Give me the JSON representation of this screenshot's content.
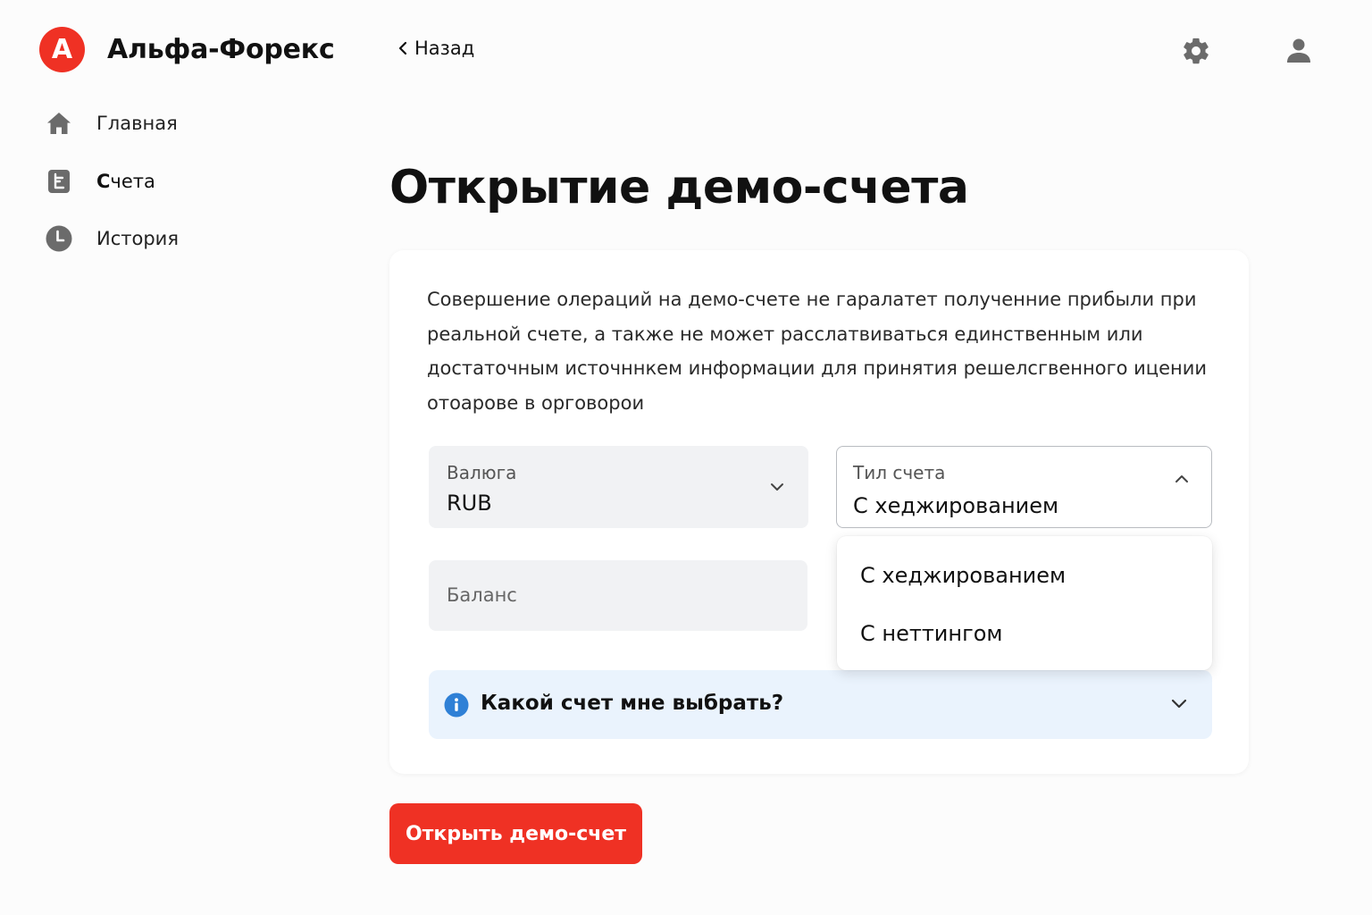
{
  "brand": {
    "logo_letter": "А",
    "name": "Альфа-Форекс",
    "color": "#ef3124"
  },
  "header": {
    "back_label": "Назад",
    "settings_icon": "gear-icon",
    "profile_icon": "user-icon"
  },
  "sidebar": {
    "items": [
      {
        "label": "Главная",
        "icon": "home-icon",
        "active": false
      },
      {
        "label_first": "С",
        "label_rest": "чета",
        "icon": "accounts-icon",
        "active": true
      },
      {
        "label": "История",
        "icon": "clock-icon",
        "active": false
      }
    ]
  },
  "page": {
    "title": "Открытие демо-счета"
  },
  "form": {
    "description": "Совершение олераций на демо-счете не гаралатет полученние прибыли при реальной счете, а также не может расслатвиваться единственным или достаточным источннкем информации для принятия решелсгвенного ицении отоарове в орговорои",
    "currency": {
      "label": "Валюга",
      "value": "RUB"
    },
    "account_type": {
      "label": "Тил счета",
      "value": "С хеджированием",
      "options": [
        "С хеджированием",
        "С неттингом"
      ]
    },
    "balance": {
      "placeholder": "Баланс"
    },
    "hint": {
      "label": "Какой счет мне выбрать?",
      "icon": "info-icon",
      "color": "#2f80d6",
      "background": "#eaf3fd"
    }
  },
  "cta": {
    "label": "Открыть демо-счет",
    "color": "#ef3124"
  }
}
